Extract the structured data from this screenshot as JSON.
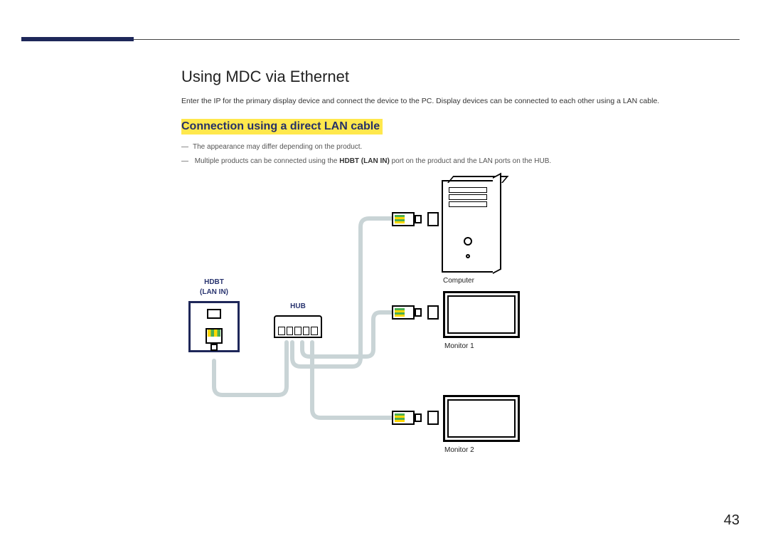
{
  "title": "Using MDC via Ethernet",
  "intro": "Enter the IP for the primary display device and connect the device to the PC. Display devices can be connected to each other using a LAN cable.",
  "subtitle": "Connection using a direct LAN cable",
  "notes": {
    "n1": "The appearance may differ depending on the product.",
    "n2_pre": "Multiple products can be connected using the ",
    "n2_bold": "HDBT (LAN IN)",
    "n2_post": " port on the product and the LAN ports on the HUB."
  },
  "labels": {
    "hdbt1": "HDBT",
    "hdbt2": "(LAN IN)",
    "hub": "HUB",
    "computer": "Computer",
    "monitor1": "Monitor 1",
    "monitor2": "Monitor 2"
  },
  "page": "43"
}
